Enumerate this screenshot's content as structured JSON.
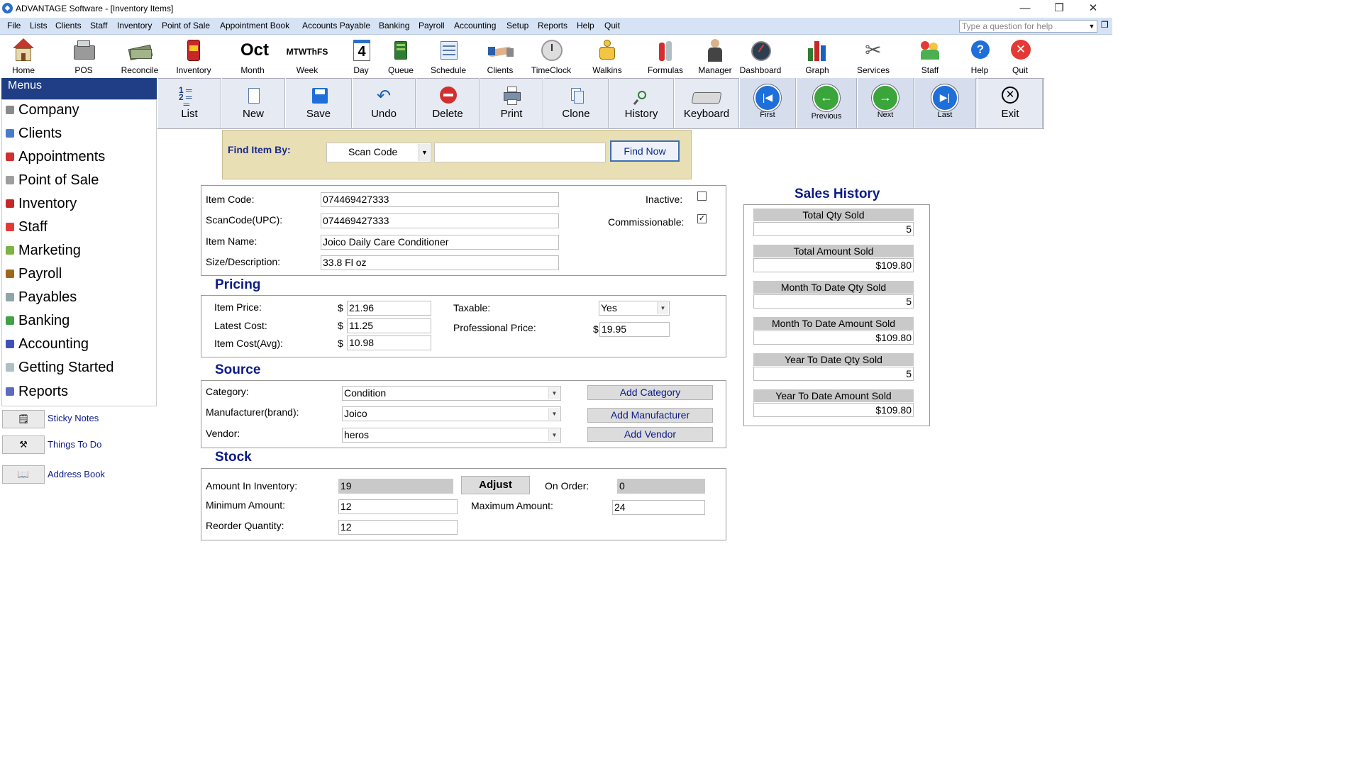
{
  "window": {
    "title": "ADVANTAGE Software - [Inventory Items]"
  },
  "menubar": {
    "items": [
      "File",
      "Lists",
      "Clients",
      "Staff",
      "Inventory",
      "Point of Sale",
      "Appointment Book",
      "Accounts Payable",
      "Banking",
      "Payroll",
      "Accounting",
      "Setup",
      "Reports",
      "Help",
      "Quit"
    ],
    "help_placeholder": "Type a question for help"
  },
  "toolbar": {
    "items": [
      "Home",
      "POS",
      "Reconcile",
      "Inventory",
      "Month",
      "Week",
      "Day",
      "Queue",
      "Schedule",
      "Clients",
      "TimeClock",
      "Walkins",
      "Formulas",
      "Manager",
      "Dashboard",
      "Graph",
      "Services",
      "Staff",
      "Help",
      "Quit"
    ],
    "month_icon_text": "Oct",
    "week_icon_text": "MTWThFS",
    "day_icon_text": "4"
  },
  "sidebar": {
    "header": "Menus",
    "items": [
      "Company",
      "Clients",
      "Appointments",
      "Point of Sale",
      "Inventory",
      "Staff",
      "Marketing",
      "Payroll",
      "Payables",
      "Banking",
      "Accounting",
      "Getting Started",
      "Reports"
    ],
    "links": [
      "Sticky Notes",
      "Things To Do",
      "Address Book"
    ]
  },
  "form_toolbar": {
    "buttons": [
      "List",
      "New",
      "Save",
      "Undo",
      "Delete",
      "Print",
      "Clone",
      "History",
      "Keyboard"
    ],
    "nav": [
      "First",
      "Previous",
      "Next",
      "Last"
    ],
    "exit": "Exit"
  },
  "find": {
    "label": "Find Item By:",
    "mode": "Scan Code",
    "query": "",
    "button": "Find Now"
  },
  "item": {
    "code_label": "Item Code:",
    "code": "074469427333",
    "scancode_label": "ScanCode(UPC):",
    "scancode": "074469427333",
    "name_label": "Item Name:",
    "name": "Joico Daily Care Conditioner",
    "size_label": "Size/Description:",
    "size": "33.8 Fl oz",
    "inactive_label": "Inactive:",
    "inactive": false,
    "commission_label": "Commissionable:",
    "commissionable": true
  },
  "pricing": {
    "title": "Pricing",
    "currency": "$",
    "price_label": "Item Price:",
    "price": "21.96",
    "latest_label": "Latest Cost:",
    "latest": "11.25",
    "avg_label": "Item Cost(Avg):",
    "avg": "10.98",
    "taxable_label": "Taxable:",
    "taxable": "Yes",
    "pro_label": "Professional Price:",
    "pro": "19.95"
  },
  "source": {
    "title": "Source",
    "category_label": "Category:",
    "category": "Condition",
    "manufacturer_label": "Manufacturer(brand):",
    "manufacturer": "Joico",
    "vendor_label": "Vendor:",
    "vendor": "heros",
    "add_category": "Add Category",
    "add_manufacturer": "Add Manufacturer",
    "add_vendor": "Add Vendor"
  },
  "stock": {
    "title": "Stock",
    "amount_label": "Amount In Inventory:",
    "amount": "19",
    "adjust": "Adjust",
    "onorder_label": "On Order:",
    "onorder": "0",
    "min_label": "Minimum Amount:",
    "min": "12",
    "max_label": "Maximum Amount:",
    "max": "24",
    "reorder_label": "Reorder Quantity:",
    "reorder": "12"
  },
  "sales_history": {
    "title": "Sales History",
    "rows": [
      {
        "label": "Total Qty Sold",
        "value": "5"
      },
      {
        "label": "Total Amount Sold",
        "value": "$109.80"
      },
      {
        "label": "Month To Date Qty Sold",
        "value": "5"
      },
      {
        "label": "Month To Date Amount Sold",
        "value": "$109.80"
      },
      {
        "label": "Year To Date Qty Sold",
        "value": "5"
      },
      {
        "label": "Year To Date Amount Sold",
        "value": "$109.80"
      }
    ]
  },
  "colors": {
    "accent": "#0b1b89",
    "menu_header": "#1f3e85",
    "find_bg": "#e9dfb4",
    "menubar": "#d5e3f5"
  }
}
